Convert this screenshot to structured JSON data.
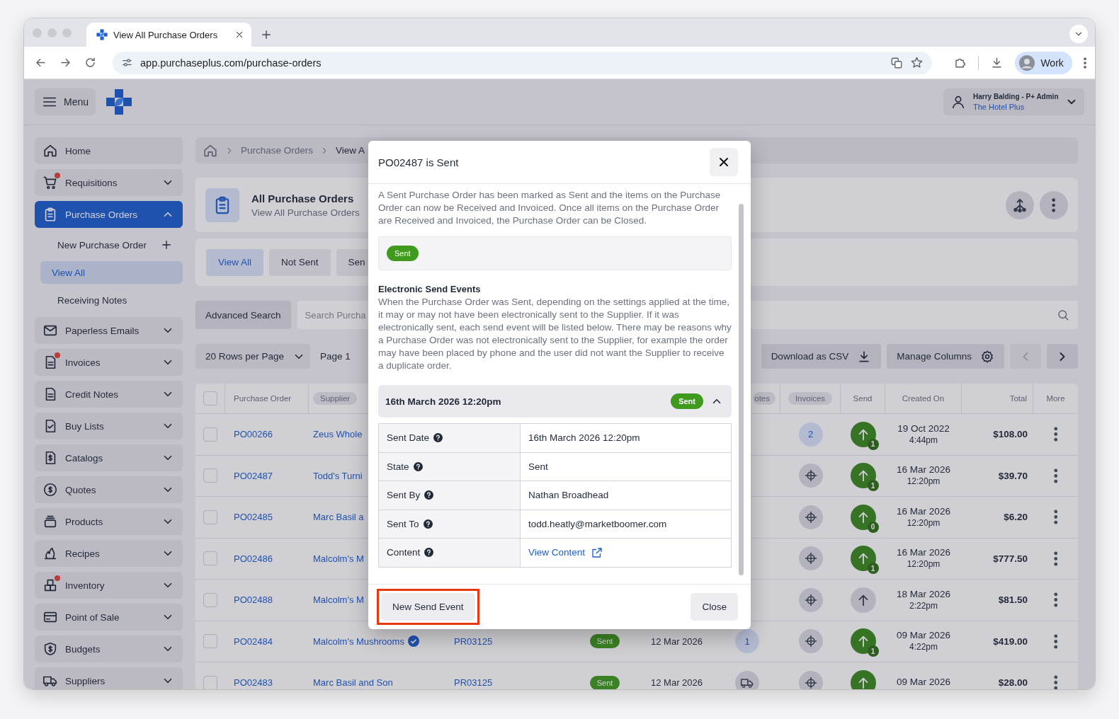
{
  "browser": {
    "tab_title": "View All Purchase Orders",
    "url": "app.purchaseplus.com/purchase-orders",
    "profile": "Work"
  },
  "header": {
    "menu_label": "Menu",
    "user_name": "Harry Balding - P+ Admin",
    "organisation": "The Hotel Plus"
  },
  "sidebar": {
    "items": [
      {
        "label": "Home",
        "selected": false,
        "alert": false
      },
      {
        "label": "Requisitions",
        "selected": false,
        "alert": true,
        "expanded": false
      },
      {
        "label": "Purchase Orders",
        "selected": true,
        "alert": false,
        "expanded": true,
        "children": [
          {
            "label": "New Purchase Order",
            "kind": "create",
            "selected": false
          },
          {
            "label": "View All",
            "kind": "link",
            "selected": true
          },
          {
            "label": "Receiving Notes",
            "kind": "link",
            "selected": false
          }
        ]
      },
      {
        "label": "Paperless Emails",
        "selected": false,
        "alert": false,
        "expanded": false
      },
      {
        "label": "Invoices",
        "selected": false,
        "alert": true,
        "expanded": false
      },
      {
        "label": "Credit Notes",
        "selected": false,
        "alert": false,
        "expanded": false
      },
      {
        "label": "Buy Lists",
        "selected": false,
        "alert": false,
        "expanded": false
      },
      {
        "label": "Catalogs",
        "selected": false,
        "alert": false,
        "expanded": false
      },
      {
        "label": "Quotes",
        "selected": false,
        "alert": false,
        "expanded": false
      },
      {
        "label": "Products",
        "selected": false,
        "alert": false,
        "expanded": false
      },
      {
        "label": "Recipes",
        "selected": false,
        "alert": false,
        "expanded": false
      },
      {
        "label": "Inventory",
        "selected": false,
        "alert": true,
        "expanded": false
      },
      {
        "label": "Point of Sale",
        "selected": false,
        "alert": false,
        "expanded": false
      },
      {
        "label": "Budgets",
        "selected": false,
        "alert": false,
        "expanded": false
      },
      {
        "label": "Suppliers",
        "selected": false,
        "alert": false,
        "expanded": false
      }
    ]
  },
  "breadcrumb": [
    "Purchase Orders",
    "View A"
  ],
  "page_header": {
    "title": "All Purchase Orders",
    "subtitle": "View All Purchase Orders"
  },
  "tabs": [
    {
      "label": "View All",
      "selected": true
    },
    {
      "label": "Not Sent",
      "selected": false
    },
    {
      "label": "Sen",
      "selected": false
    }
  ],
  "search": {
    "button": "Advanced Search",
    "placeholder": "Search Purcha"
  },
  "toolbar": {
    "page_size": "20 Rows per Page",
    "page": "Page 1",
    "download": "Download as CSV",
    "manage": "Manage Columns",
    "previous_disabled": true,
    "next_disabled": false
  },
  "table": {
    "all_selected": false,
    "columns": [
      {
        "label": "Purchase Order",
        "kind": "plain"
      },
      {
        "label": "Supplier",
        "kind": "pill"
      },
      {
        "label": "otes",
        "kind": "pill"
      },
      {
        "label": "Invoices",
        "kind": "pill"
      },
      {
        "label": "Send",
        "kind": "plain"
      },
      {
        "label": "Created On",
        "kind": "plain"
      },
      {
        "label": "Total",
        "kind": "plain"
      },
      {
        "label": "More",
        "kind": "plain"
      }
    ],
    "rows": [
      {
        "selected": false,
        "po": "PO00266",
        "supplier": "Zeus Whole",
        "invoices": {
          "kind": "count",
          "value": "2"
        },
        "send": {
          "active": true,
          "count": "1"
        },
        "created_date": "19 Oct 2022",
        "created_time": "4:44pm",
        "total": "$108.00"
      },
      {
        "selected": false,
        "po": "PO02487",
        "supplier": "Todd's Turni",
        "invoices": {
          "kind": "target"
        },
        "send": {
          "active": true,
          "count": "1"
        },
        "created_date": "16 Mar 2026",
        "created_time": "12:20pm",
        "total": "$39.70"
      },
      {
        "selected": false,
        "po": "PO02485",
        "supplier": "Marc Basil a",
        "invoices": {
          "kind": "target"
        },
        "send": {
          "active": true,
          "count": "0"
        },
        "created_date": "16 Mar 2026",
        "created_time": "12:20pm",
        "total": "$6.20"
      },
      {
        "selected": false,
        "po": "PO02486",
        "supplier": "Malcolm's M",
        "invoices": {
          "kind": "target"
        },
        "send": {
          "active": true,
          "count": "1"
        },
        "created_date": "16 Mar 2026",
        "created_time": "12:20pm",
        "total": "$777.50"
      },
      {
        "selected": false,
        "po": "PO02488",
        "supplier": "Malcolm's M",
        "invoices": {
          "kind": "target"
        },
        "send": {
          "active": false
        },
        "created_date": "18 Mar 2026",
        "created_time": "2:22pm",
        "total": "$81.50"
      },
      {
        "selected": false,
        "po": "PO02484",
        "supplier": "Malcolm's Mushrooms",
        "verified": true,
        "requisition": "PR03125",
        "status": "Sent",
        "date": "12 Mar 2026",
        "notes": {
          "kind": "count",
          "value": "1"
        },
        "invoices": {
          "kind": "target"
        },
        "send": {
          "active": true,
          "count": "1"
        },
        "created_date": "09 Mar 2026",
        "created_time": "4:22pm",
        "total": "$419.00"
      },
      {
        "selected": false,
        "po": "PO02483",
        "supplier": "Marc Basil and Son",
        "verified": false,
        "requisition": "PR03125",
        "status": "Sent",
        "date": "12 Mar 2026",
        "notes": {
          "kind": "truck"
        },
        "invoices": {
          "kind": "target"
        },
        "send": {
          "active": true
        },
        "created_date": "09 Mar 2026",
        "total": "$28.00"
      }
    ]
  },
  "modal": {
    "title": "PO02487 is Sent",
    "status_text": "A Sent Purchase Order has been marked as Sent and the items on the Purchase Order can now be Received and Invoiced. Once all items on the Purchase Order are Received and Invoiced, the Purchase Order can be Closed.",
    "status_badge": "Sent",
    "events_heading": "Electronic Send Events",
    "events_text": "When the Purchase Order was Sent, depending on the settings applied at the time, it may or may not have been electronically sent to the Supplier. If it was electronically sent, each send event will be listed below. There may be reasons why a Purchase Order was not electronically sent to the Supplier, for example the order may have been placed by phone and the user did not want the Supplier to receive a duplicate order.",
    "events": [
      {
        "title": "16th March 2026 12:20pm",
        "badge": "Sent",
        "expanded": true,
        "details": [
          {
            "label": "Sent Date",
            "value": "16th March 2026 12:20pm",
            "kind": "text"
          },
          {
            "label": "State",
            "value": "Sent",
            "kind": "text"
          },
          {
            "label": "Sent By",
            "value": "Nathan Broadhead",
            "kind": "text"
          },
          {
            "label": "Sent To",
            "value": "todd.heatly@marketboomer.com",
            "kind": "text"
          },
          {
            "label": "Content",
            "value": "View Content",
            "kind": "link"
          }
        ]
      }
    ],
    "buttons": [
      {
        "label": "New Send Event",
        "highlighted": true
      },
      {
        "label": "Close",
        "highlighted": false
      }
    ]
  }
}
